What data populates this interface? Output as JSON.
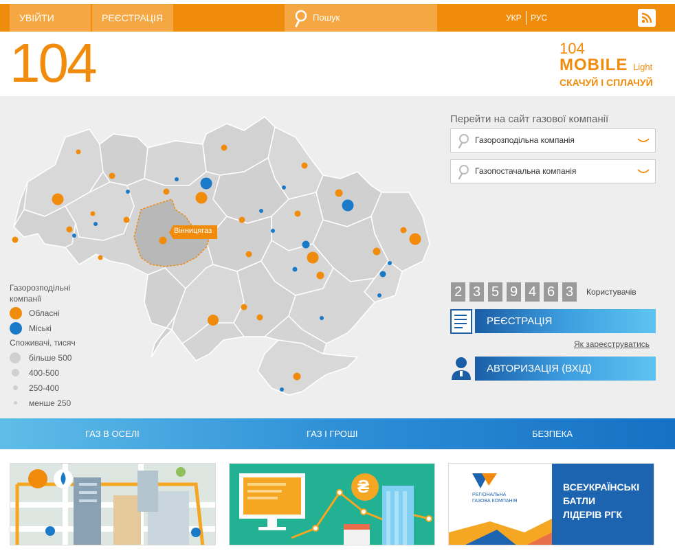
{
  "topbar": {
    "login_label": "УВІЙТИ",
    "register_label": "РЕЄСТРАЦІЯ",
    "search_placeholder": "Пошук",
    "lang_ukr": "УКР",
    "lang_rus": "РУС",
    "rss_icon": "rss-icon"
  },
  "brand": {
    "logo_text": "104",
    "mobile_line1": "104",
    "mobile_line2": "MOBILE",
    "mobile_light": "Light",
    "mobile_line3": "СКАЧУЙ І СПЛАЧУЙ"
  },
  "map": {
    "highlight_label": "Вінницягаз",
    "region_fill": "#cfcfcf",
    "highlight_fill": "#b5b5b5",
    "orange": "#f18b0b",
    "blue": "#1a7ac8"
  },
  "legend": {
    "companies_title": "Газорозподільні компанії",
    "oblast_label": "Обласні",
    "city_label": "Міські",
    "consumers_title": "Споживачі, тисяч",
    "size1": "більше 500",
    "size2": "400-500",
    "size3": "250-400",
    "size4": "менше 250"
  },
  "company_select": {
    "title": "Перейти на сайт газової компанії",
    "distribution": "Газорозподільна компанія",
    "supply": "Газопостачальна компанія"
  },
  "counter": {
    "digits": [
      "2",
      "3",
      "5",
      "9",
      "4",
      "6",
      "3"
    ],
    "label": "Користувачів"
  },
  "actions": {
    "register": "РЕЄСТРАЦІЯ",
    "how_register": "Як зареєструватись",
    "auth": "АВТОРИЗАЦІЯ (ВХІД)"
  },
  "nav": {
    "item1": "ГАЗ В ОСЕЛІ",
    "item2": "ГАЗ І ГРОШІ",
    "item3": "БЕЗПЕКА"
  },
  "cards": {
    "rgk_small1": "РЕГІОНАЛЬНА",
    "rgk_small2": "ГАЗОВА КОМПАНІЯ",
    "battle1": "ВСЕУКРАЇНСЬКІ",
    "battle2": "БАТЛИ",
    "battle3": "ЛІДЕРІВ РГК",
    "currency_symbol": "₴"
  }
}
